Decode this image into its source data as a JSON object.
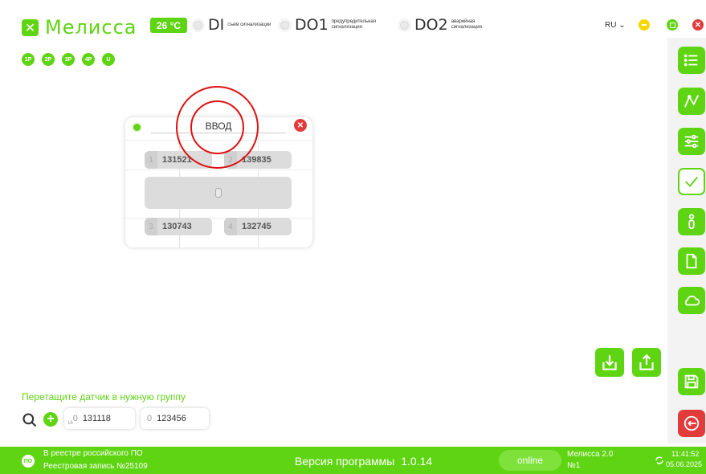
{
  "app": {
    "name": "Мелисса",
    "temperature": "26 °C",
    "language": "RU ⌄"
  },
  "signals": [
    {
      "code": "DI",
      "desc": "съем сигнализации"
    },
    {
      "code": "DO1",
      "desc": "предупредительная сигнализация"
    },
    {
      "code": "DO2",
      "desc": "аварийная сигнализация"
    }
  ],
  "phases": [
    "1P",
    "2P",
    "3P",
    "4P",
    "U"
  ],
  "group_card": {
    "title": "ВВОД",
    "slots": [
      {
        "index": "1",
        "value": "131521"
      },
      {
        "index": "2",
        "value": "139835"
      },
      {
        "index": "3",
        "value": "130743"
      },
      {
        "index": "4",
        "value": "132745"
      }
    ]
  },
  "toolbar": {
    "items": [
      "list-icon",
      "chart-icon",
      "settings-icon",
      "check-icon",
      "info-icon",
      "document-icon",
      "cloud-icon",
      "save-icon",
      "exit-icon"
    ]
  },
  "sensor_area": {
    "hint": "Перетащите датчик в нужную группу",
    "sensors": [
      {
        "index": "0",
        "subscript": "16",
        "value": "131118"
      },
      {
        "index": "0",
        "value": "123456"
      }
    ]
  },
  "footer": {
    "registry_line1": "В реестре российского ПО",
    "registry_line2": "Реестровая запись №25109",
    "version_label": "Версия программы",
    "version": "1.0.14",
    "status": "online",
    "device_line1": "Мелисса 2.0",
    "device_line2": "№1",
    "time": "11:41:52",
    "date": "05.06.2025"
  },
  "colors": {
    "accent": "#5fd412",
    "danger": "#e23b3b",
    "warning": "#f5d800"
  }
}
